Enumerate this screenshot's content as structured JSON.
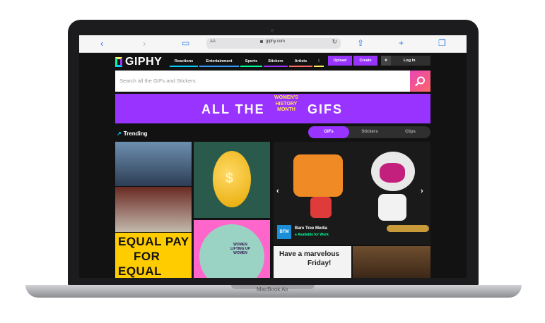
{
  "device": {
    "label": "MacBook Air"
  },
  "browser": {
    "address_prefix": "AA",
    "url": "giphy.com"
  },
  "header": {
    "logo": "GIPHY",
    "tabs": [
      {
        "label": "Reactions",
        "color": "#00ccff"
      },
      {
        "label": "Entertainment",
        "color": "#3399ff"
      },
      {
        "label": "Sports",
        "color": "#00ff99"
      },
      {
        "label": "Stickers",
        "color": "#9933ff"
      },
      {
        "label": "Artists",
        "color": "#ff6666"
      },
      {
        "label": "⋮",
        "color": "#fff35c"
      }
    ],
    "upload": "Upload",
    "create": "Create",
    "login": "Log In"
  },
  "search": {
    "placeholder": "Search all the GIFs and Stickers"
  },
  "banner": {
    "left": "ALL THE",
    "badge": "WOMEN'S HISTORY MONTH",
    "right": "GIFS"
  },
  "trending": {
    "title": "Trending",
    "toggles": [
      "GIFs",
      "Stickers",
      "Clips"
    ],
    "active": "GIFs"
  },
  "tiles": {
    "equal_pay_1": "EQUAL PAY",
    "equal_pay_2": "FOR",
    "equal_pay_3": "EQUAL WORK",
    "women_text": "WOMEN LIFTING UP WOMEN",
    "marvelous_1": "Have a marvelous",
    "marvelous_2": "Friday!",
    "featured_creator": "Bare Tree Media",
    "featured_status": "● Available for Work",
    "featured_logo": "BTM"
  },
  "colors": {
    "accent": "#9933ff",
    "background": "#121212",
    "search_button": "#e646b6"
  }
}
